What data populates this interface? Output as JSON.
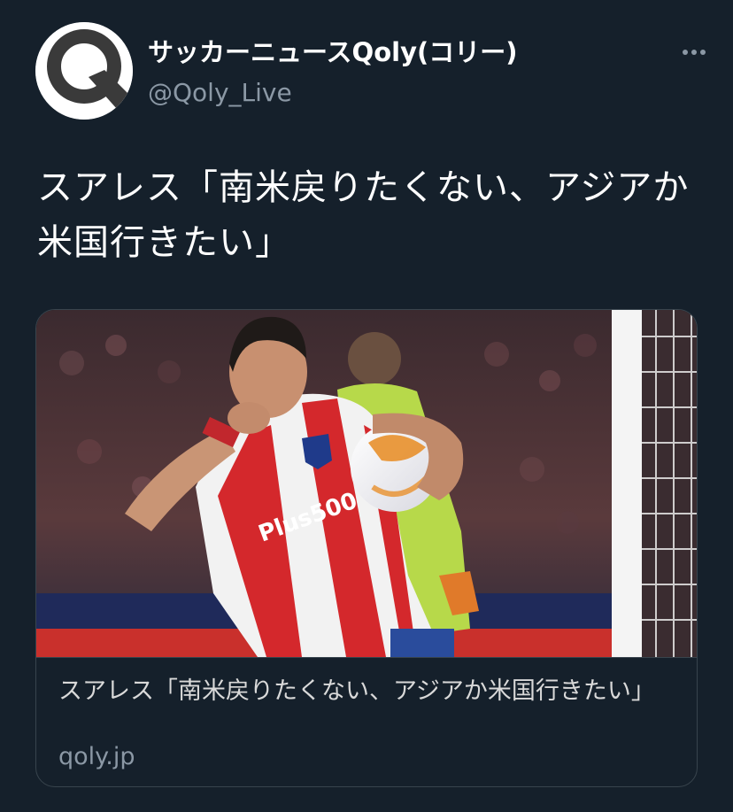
{
  "account": {
    "display_name": "サッカーニュースQoly(コリー)",
    "handle": "@Qoly_Live"
  },
  "tweet": {
    "text": "スアレス「南米戻りたくない、アジアか米国行きたい」"
  },
  "card": {
    "title": "スアレス「南米戻りたくない、アジアか米国行きたい」",
    "domain": "qoly.jp",
    "image_text": "Plus500"
  },
  "colors": {
    "background": "#15202b",
    "secondary_text": "#8b98a5",
    "border": "#38444d"
  },
  "icons": {
    "avatar": "qoly-logo-icon",
    "more": "more-dots-icon"
  }
}
